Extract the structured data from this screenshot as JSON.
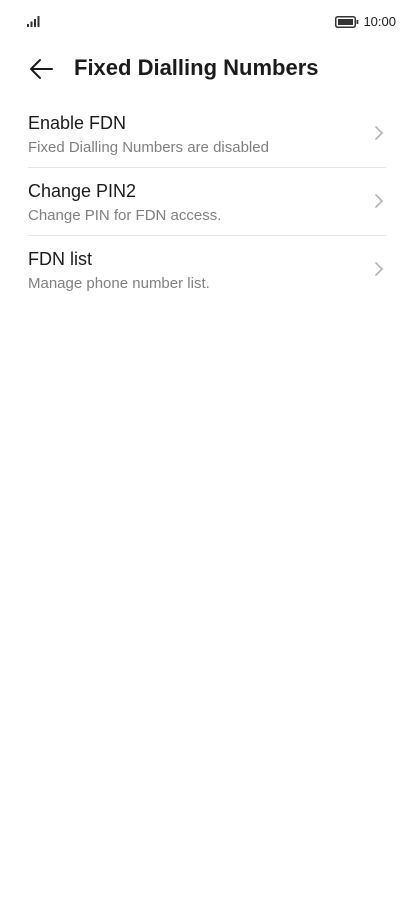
{
  "status_bar": {
    "time": "10:00",
    "signal_icon": "signal-icon",
    "battery_icon": "battery-icon"
  },
  "header": {
    "back_icon": "arrow-left-icon",
    "title": "Fixed Dialling Numbers"
  },
  "items": [
    {
      "title": "Enable FDN",
      "subtitle": "Fixed Dialling Numbers are disabled",
      "icon": "chevron-right-icon"
    },
    {
      "title": "Change PIN2",
      "subtitle": "Change PIN for FDN access.",
      "icon": "chevron-right-icon"
    },
    {
      "title": "FDN list",
      "subtitle": "Manage phone number list.",
      "icon": "chevron-right-icon"
    }
  ],
  "colors": {
    "text_primary": "#1b1b1b",
    "text_secondary": "#808080",
    "divider": "#e6e6e6",
    "chevron": "#b3b3b3"
  }
}
